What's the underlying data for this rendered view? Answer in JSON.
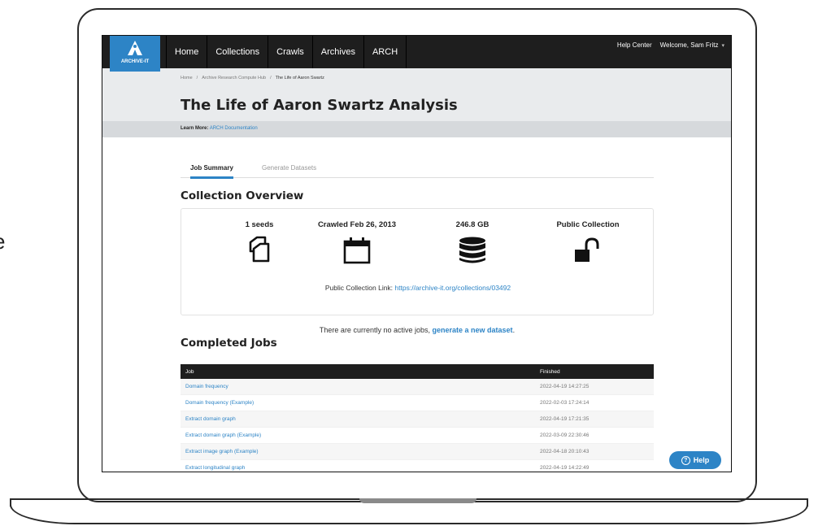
{
  "edge_text": "e",
  "nav": {
    "logo_text": "ARCHIVE-IT",
    "items": [
      "Home",
      "Collections",
      "Crawls",
      "Archives",
      "ARCH"
    ],
    "help_center": "Help Center",
    "welcome": "Welcome, Sam Fritz"
  },
  "breadcrumb": [
    "Home",
    "Archive Research Compute Hub",
    "The Life of Aaron Swartz"
  ],
  "page_title": "The Life of Aaron Swartz Analysis",
  "learn_more": {
    "label": "Learn More:",
    "link": "ARCH Documentation"
  },
  "tabs": [
    "Job Summary",
    "Generate Datasets"
  ],
  "overview": {
    "heading": "Collection Overview",
    "seeds": "1 seeds",
    "crawled": "Crawled Feb 26, 2013",
    "size": "246.8 GB",
    "access": "Public Collection",
    "public_link_label": "Public Collection Link:",
    "public_link": "https://archive-it.org/collections/03492"
  },
  "active_jobs": {
    "text": "There are currently no active jobs,",
    "link": "generate a new dataset",
    "end": "."
  },
  "completed": {
    "heading": "Completed Jobs",
    "columns": [
      "Job",
      "Finished"
    ],
    "rows": [
      {
        "job": "Domain frequency",
        "finished": "2022-04-19 14:27:25"
      },
      {
        "job": "Domain frequency (Example)",
        "finished": "2022-02-03 17:24:14"
      },
      {
        "job": "Extract domain graph",
        "finished": "2022-04-19 17:21:35"
      },
      {
        "job": "Extract domain graph (Example)",
        "finished": "2022-03-09 22:30:46"
      },
      {
        "job": "Extract image graph (Example)",
        "finished": "2022-04-18 20:10:43"
      },
      {
        "job": "Extract longitudinal graph",
        "finished": "2022-04-19 14:22:49"
      }
    ]
  },
  "help_button": "Help",
  "colors": {
    "accent": "#2d84c6",
    "nav_bg": "#1e1e1e",
    "header_bg": "#e9ebed"
  }
}
